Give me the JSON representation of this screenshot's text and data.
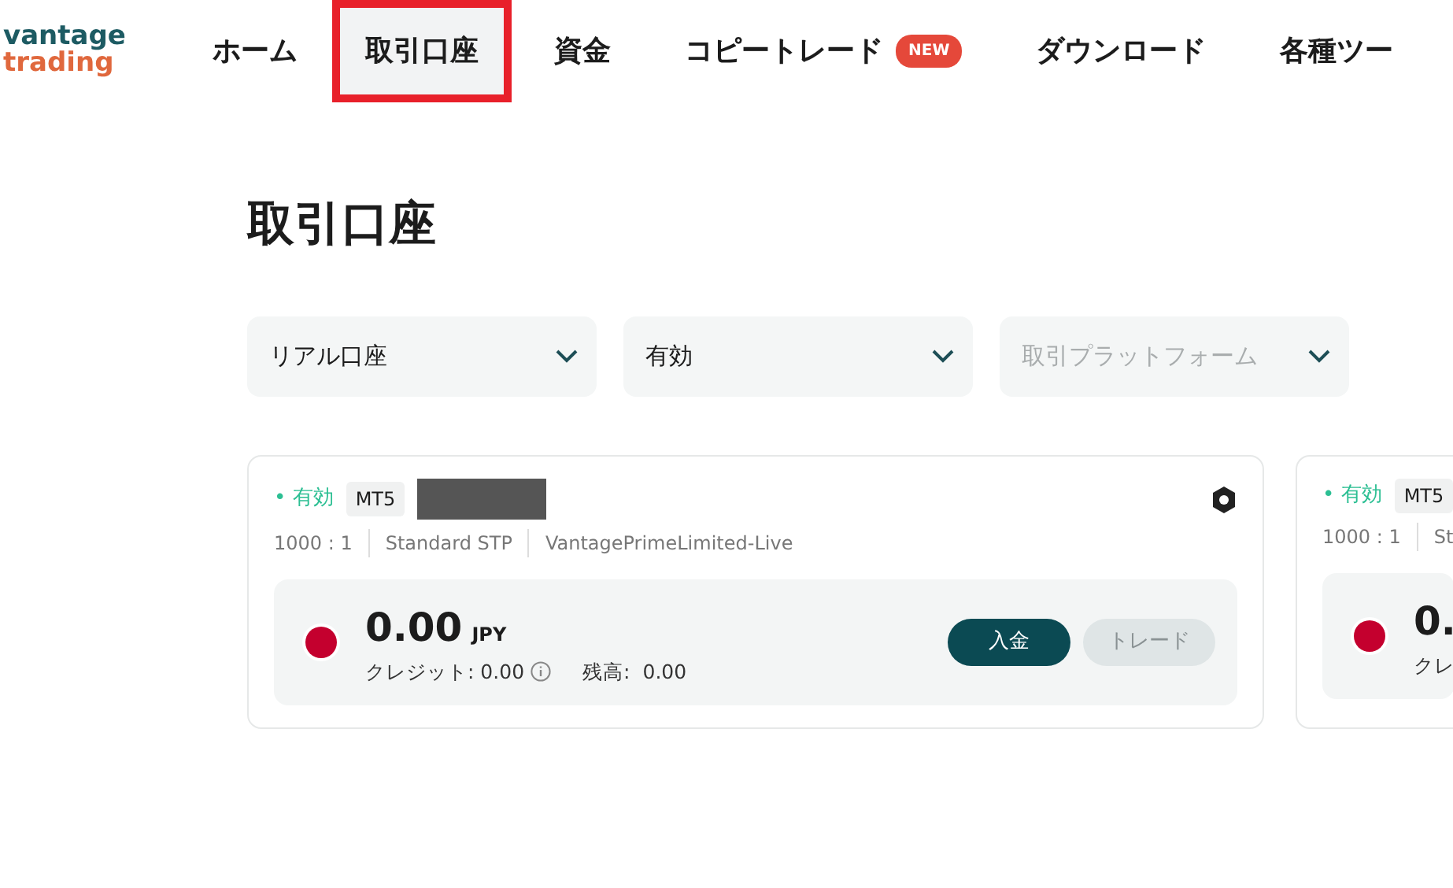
{
  "logo": {
    "line1": "vantage",
    "line2": "trading"
  },
  "nav": [
    {
      "label": "ホーム",
      "selected": false,
      "highlighted": false
    },
    {
      "label": "取引口座",
      "selected": true,
      "highlighted": true
    },
    {
      "label": "資金",
      "selected": false,
      "highlighted": false
    },
    {
      "label": "コピートレード",
      "selected": false,
      "highlighted": false,
      "badge": "NEW"
    },
    {
      "label": "ダウンロード",
      "selected": false,
      "highlighted": false
    },
    {
      "label": "各種ツー",
      "selected": false,
      "highlighted": false
    }
  ],
  "page_title": "取引口座",
  "filters": [
    {
      "value": "リアル口座"
    },
    {
      "value": "有効"
    },
    {
      "placeholder": "取引プラットフォーム"
    }
  ],
  "accounts": [
    {
      "status": "• 有効",
      "platform": "MT5",
      "redacted": true,
      "leverage": "1000 : 1",
      "type": "Standard STP",
      "server": "VantagePrimeLimited-Live",
      "amount": "0.00",
      "currency": "JPY",
      "credit": "クレジット: 0.00",
      "balance_label": "残高:",
      "balance": "0.00",
      "deposit": "入金",
      "trade": "トレード"
    },
    {
      "status": "• 有効",
      "platform": "MT5",
      "leverage": "1000 : 1",
      "type": "St",
      "amount": "0.",
      "credit": "クレ"
    }
  ]
}
